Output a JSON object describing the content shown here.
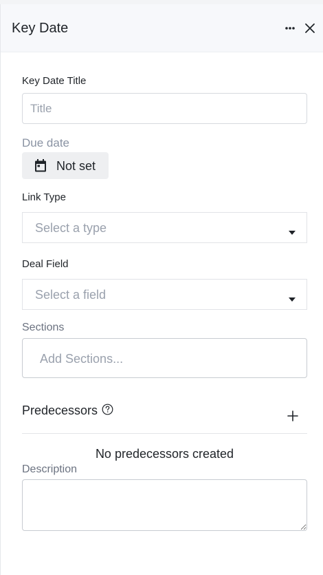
{
  "header": {
    "title": "Key Date",
    "more_icon": "more-horizontal-icon",
    "close_icon": "close-icon"
  },
  "form": {
    "title_label": "Key Date Title",
    "title_placeholder": "Title",
    "title_value": "",
    "due_date_label": "Due date",
    "due_date_value": "Not set",
    "due_date_icon": "calendar-icon",
    "link_type_label": "Link Type",
    "link_type_placeholder": "Select a type",
    "deal_field_label": "Deal Field",
    "deal_field_placeholder": "Select a field",
    "sections_label": "Sections",
    "sections_placeholder": "Add Sections...",
    "predecessors_label": "Predecessors",
    "predecessors_empty": "No predecessors created",
    "description_label": "Description",
    "description_value": ""
  },
  "colors": {
    "header_bg": "#f7f8fb",
    "muted_text": "#8a93a3",
    "placeholder": "#9aa1ad",
    "date_button_bg": "#eeeff1"
  }
}
